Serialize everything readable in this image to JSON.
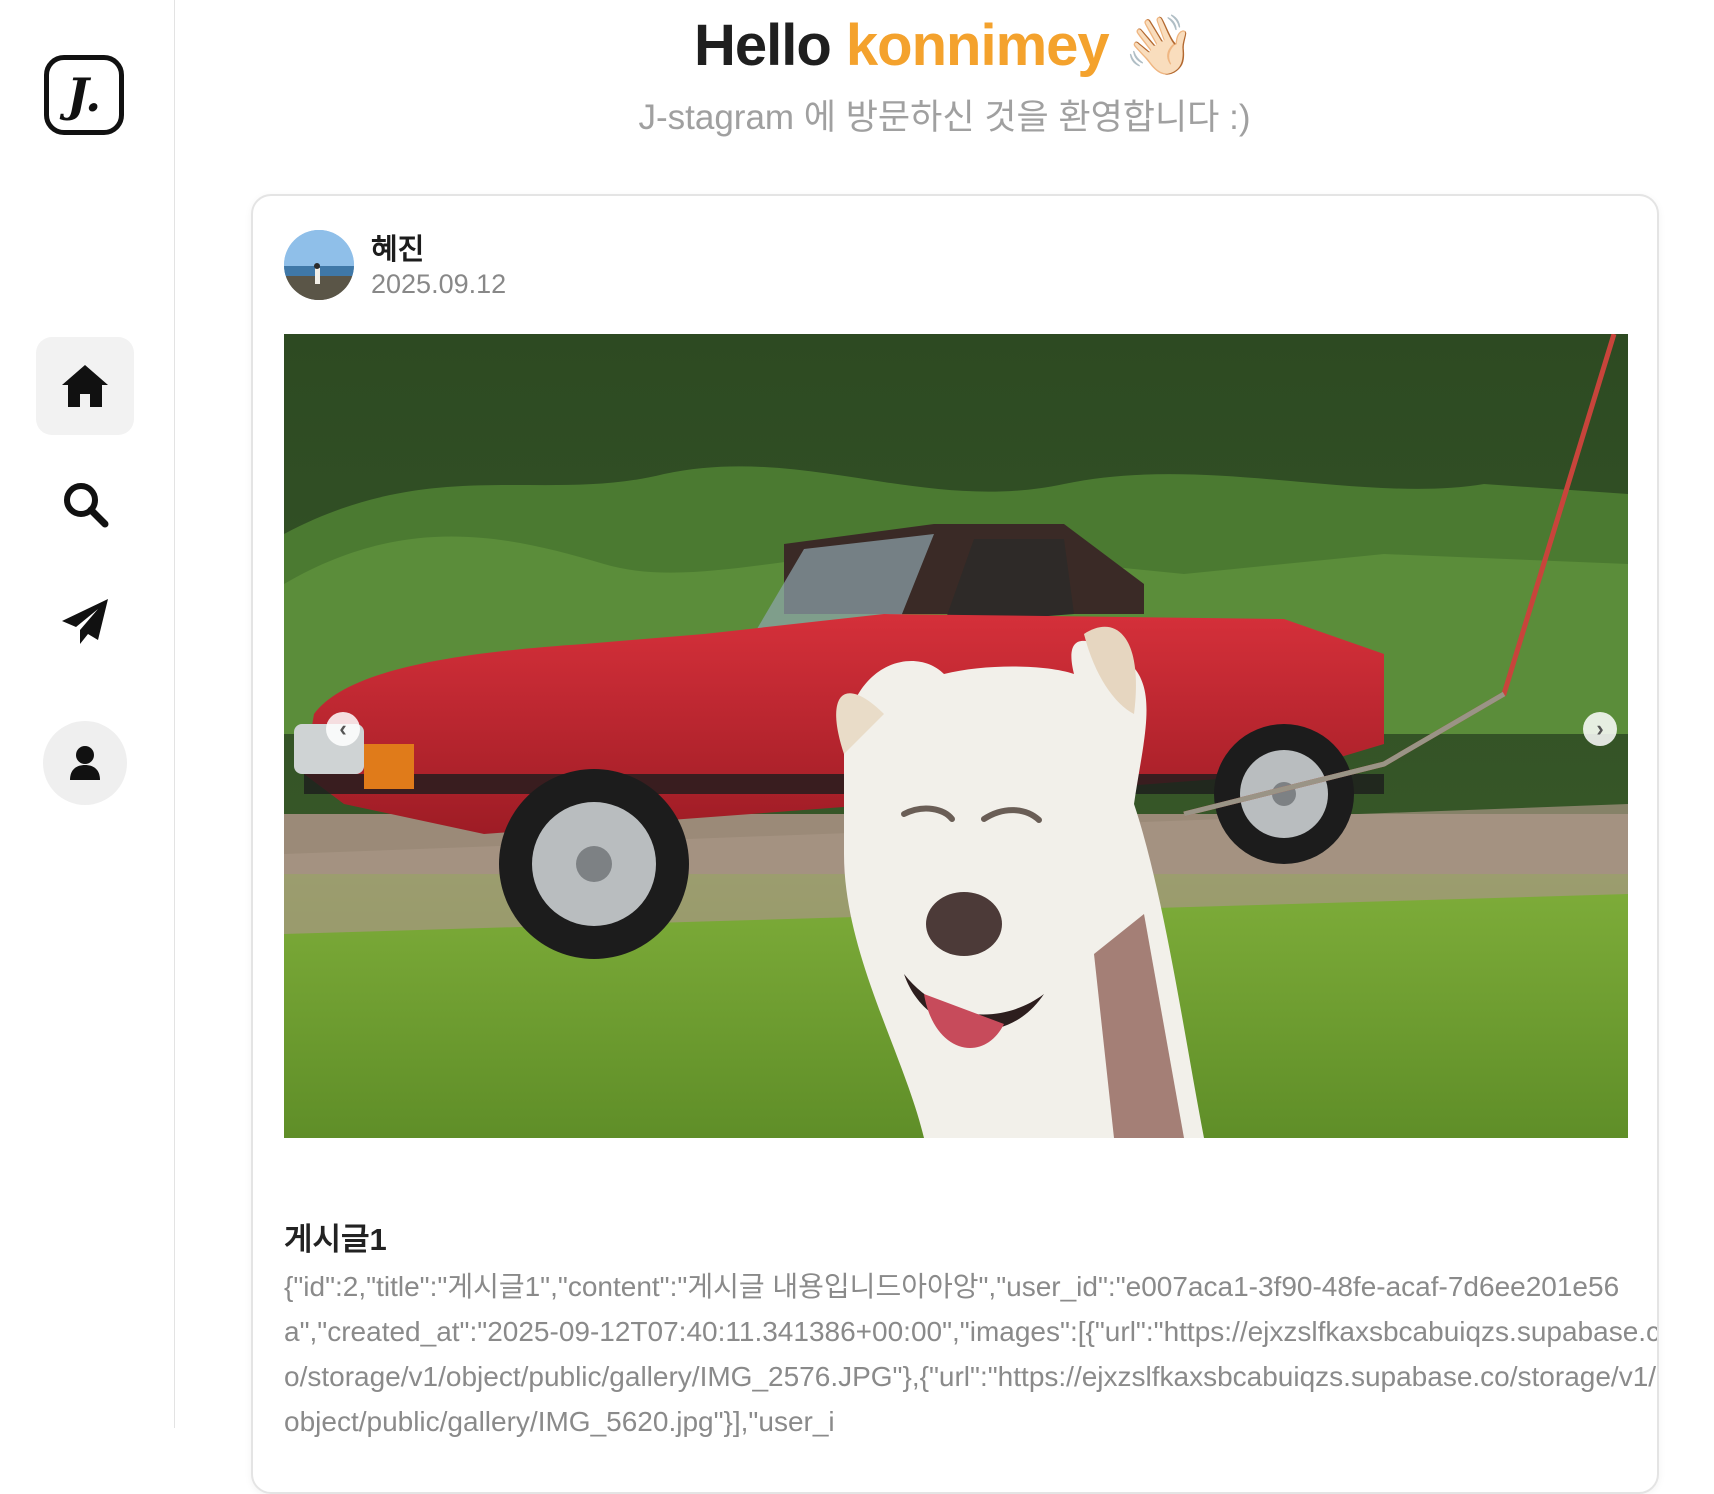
{
  "sidebar": {
    "logo_text": "J.",
    "items": [
      {
        "name": "home",
        "icon": "home-icon",
        "active": true
      },
      {
        "name": "search",
        "icon": "search-icon",
        "active": false
      },
      {
        "name": "send",
        "icon": "paper-plane-icon",
        "active": false
      },
      {
        "name": "profile",
        "icon": "user-icon",
        "active": false
      }
    ]
  },
  "header": {
    "greeting": "Hello",
    "username": "konnimey",
    "wave": "👋🏻",
    "subtitle": "J-stagram 에 방문하신 것을 환영합니다 :)"
  },
  "post": {
    "author": "혜진",
    "date": "2025.09.12",
    "title": "게시글1",
    "content": "{\"id\":2,\"title\":\"게시글1\",\"content\":\"게시글 내용입니드아아앙\",\"user_id\":\"e007aca1-3f90-48fe-acaf-7d6ee201e56a\",\"created_at\":\"2025-09-12T07:40:11.341386+00:00\",\"images\":[{\"url\":\"https://ejxzslfkaxsbcabuiqzs.supabase.co/storage/v1/object/public/gallery/IMG_2576.JPG\"},{\"url\":\"https://ejxzslfkaxsbcabuiqzs.supabase.co/storage/v1/object/public/gallery/IMG_5620.jpg\"}],\"user_i",
    "carousel": {
      "prev_icon": "chevron-left-icon",
      "next_icon": "chevron-right-icon"
    }
  },
  "colors": {
    "accent": "#f4a22d",
    "muted": "#a0a0a0"
  }
}
